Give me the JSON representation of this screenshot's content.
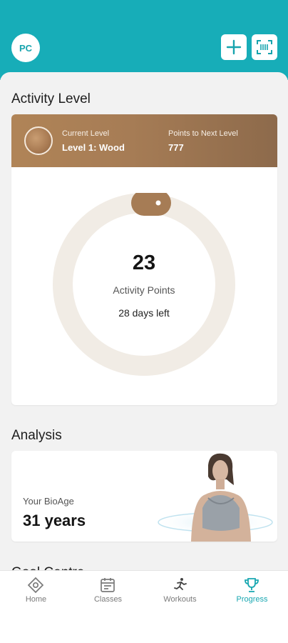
{
  "header": {
    "avatar_initials": "PC",
    "add_icon": "plus-icon",
    "scan_icon": "barcode-scan-icon",
    "background_color": "#17adb8"
  },
  "activity": {
    "section_title": "Activity Level",
    "current_level_label": "Current Level",
    "current_level_value": "Level 1: Wood",
    "next_level_label": "Points to Next Level",
    "next_level_value": "777",
    "points": "23",
    "points_label": "Activity Points",
    "days_left": "28 days left",
    "level_color": "#a67c55"
  },
  "analysis": {
    "section_title": "Analysis",
    "bioage_label": "Your BioAge",
    "bioage_value": "31 years"
  },
  "next_section_title": "Goal Centre",
  "nav": [
    {
      "label": "Home",
      "icon": "home-icon"
    },
    {
      "label": "Classes",
      "icon": "classes-calendar-icon"
    },
    {
      "label": "Workouts",
      "icon": "workouts-runner-icon"
    },
    {
      "label": "Progress",
      "icon": "trophy-icon",
      "active": true
    }
  ],
  "accent_color": "#18a7b1"
}
